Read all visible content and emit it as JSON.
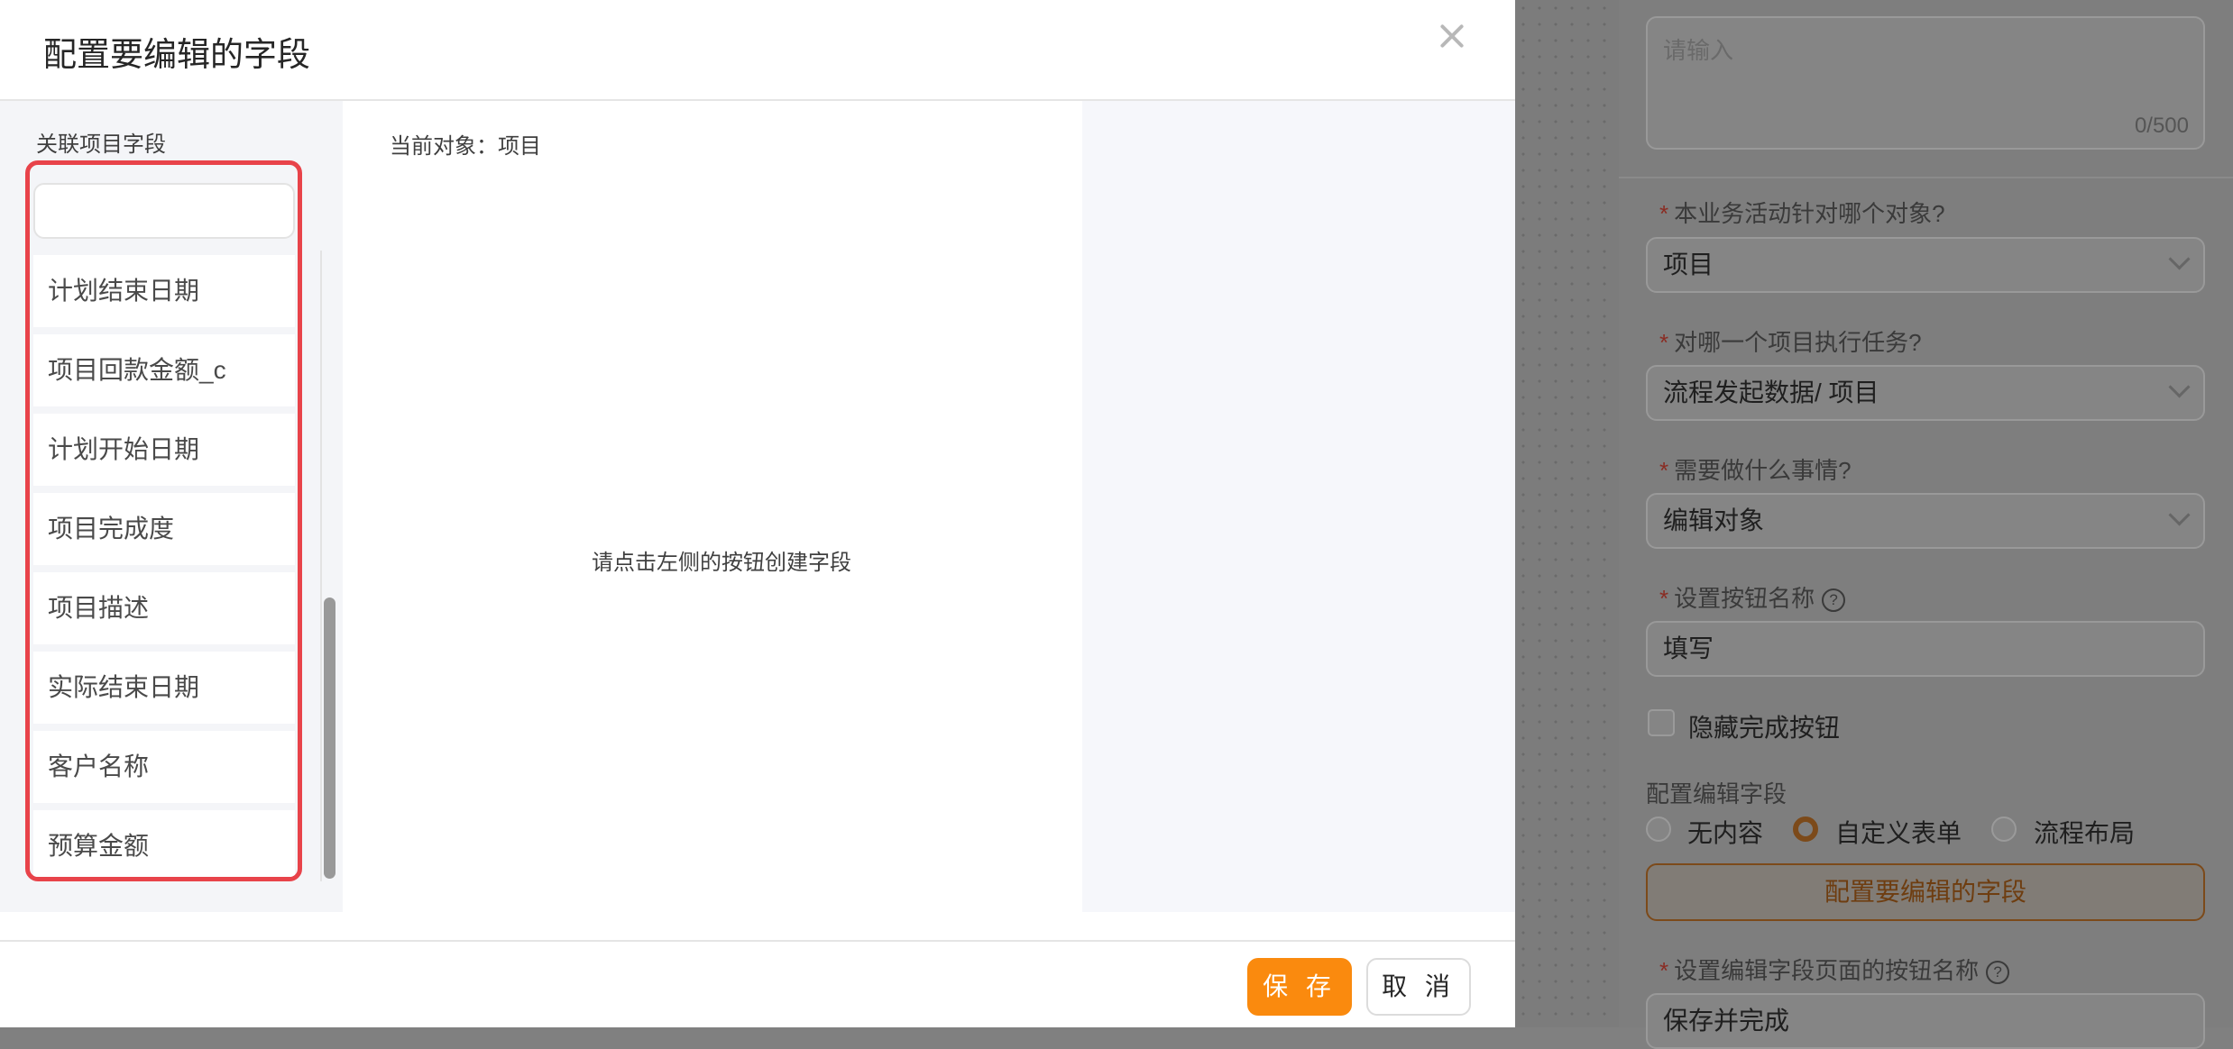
{
  "modal": {
    "title": "配置要编辑的字段",
    "left_title": "关联项目字段",
    "search_value": "",
    "fields": [
      "计划结束日期",
      "项目回款金额_c",
      "计划开始日期",
      "项目完成度",
      "项目描述",
      "实际结束日期",
      "客户名称",
      "预算金额"
    ],
    "current_object": "当前对象：项目",
    "empty_hint": "请点击左侧的按钮创建字段",
    "save_label": "保 存",
    "cancel_label": "取 消"
  },
  "settings": {
    "description_placeholder": "请输入",
    "description_counter": "0/500",
    "q_object": "本业务活动针对哪个对象?",
    "q_object_value": "项目",
    "q_target": "对哪一个项目执行任务?",
    "q_target_value": "流程发起数据/ 项目",
    "q_action": "需要做什么事情?",
    "q_action_value": "编辑对象",
    "button_name_label": "设置按钮名称",
    "button_name_value": "填写",
    "hide_complete_label": "隐藏完成按钮",
    "config_fields_label": "配置编辑字段",
    "radio_options": [
      "无内容",
      "自定义表单",
      "流程布局"
    ],
    "radio_selected": "自定义表单",
    "config_button_label": "配置要编辑的字段",
    "edit_page_button_label": "设置编辑字段页面的按钮名称",
    "edit_page_button_value": "保存并完成",
    "required_mark": "*",
    "help_icon_glyph": "?"
  },
  "colors": {
    "accent": "#fa8a0e",
    "highlight_border": "#e8434a"
  }
}
